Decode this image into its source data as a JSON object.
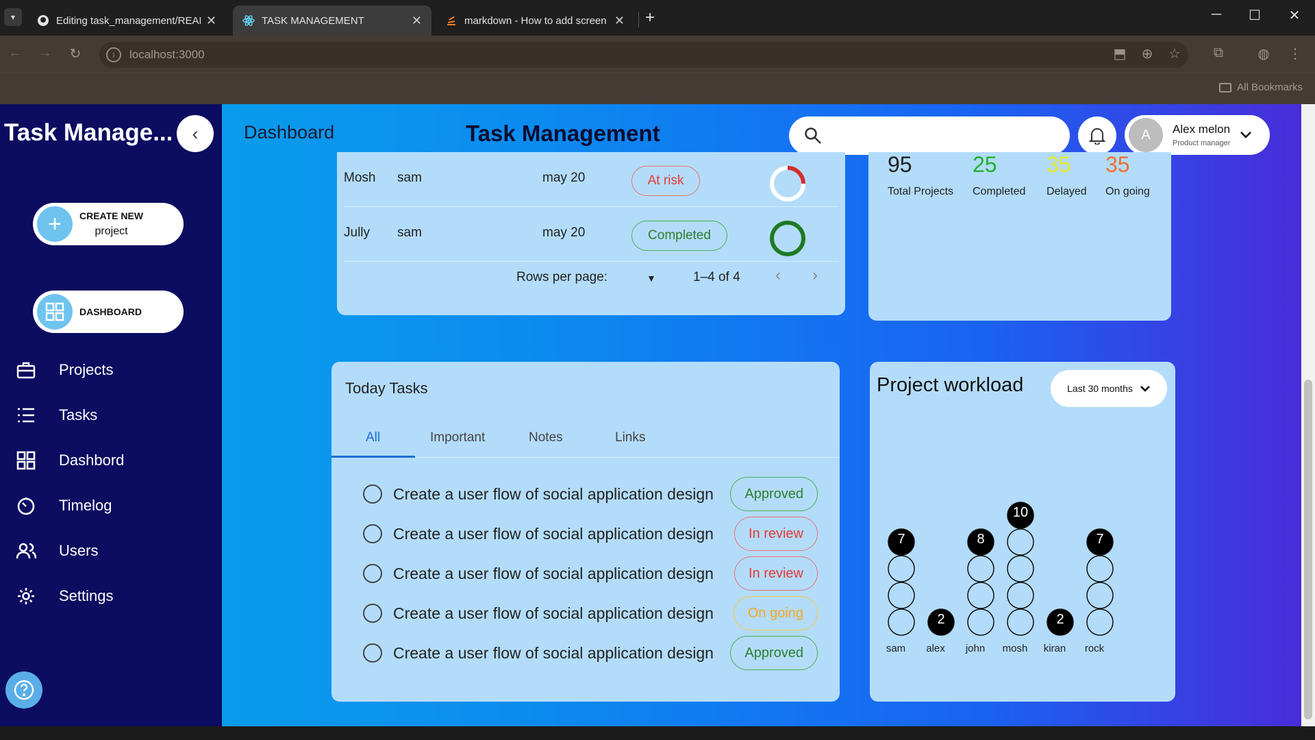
{
  "browser": {
    "tabs": [
      {
        "title": "Editing task_management/READ",
        "active": false
      },
      {
        "title": "TASK MANAGEMENT",
        "active": true
      },
      {
        "title": "markdown - How to add screen",
        "active": false
      }
    ],
    "url": "localhost:3000",
    "bookmarks_label": "All Bookmarks"
  },
  "sidebar": {
    "brand": "Task Manage...",
    "create_btn": {
      "line1": "CREATE NEW",
      "line2": "project"
    },
    "dashboard_btn": "DASHBOARD",
    "items": [
      {
        "label": "Projects",
        "icon": "briefcase-icon"
      },
      {
        "label": "Tasks",
        "icon": "list-icon"
      },
      {
        "label": "Dashbord",
        "icon": "grid-icon"
      },
      {
        "label": "Timelog",
        "icon": "timer-icon"
      },
      {
        "label": "Users",
        "icon": "users-icon"
      },
      {
        "label": "Settings",
        "icon": "gear-icon"
      }
    ]
  },
  "header": {
    "breadcrumb": "Dashboard",
    "title": "Task Management",
    "search_placeholder": "",
    "user": {
      "initial": "A",
      "name": "Alex melon",
      "role": "Product manager"
    }
  },
  "project_table": {
    "rows": [
      {
        "name": "Mosh",
        "manager": "sam",
        "due": "may 20",
        "status": "At risk",
        "status_color": "#e53935",
        "progress": 0.25
      },
      {
        "name": "Jully",
        "manager": "sam",
        "due": "may 20",
        "status": "Completed",
        "status_color": "#2e7d32",
        "progress": 1.0
      }
    ],
    "pager": {
      "rows_label": "Rows per page:",
      "range": "1–4 of 4"
    }
  },
  "overview": {
    "stats": [
      {
        "value": "95",
        "label": "Total Projects",
        "color": "#222222"
      },
      {
        "value": "25",
        "label": "Completed",
        "color": "#1fb12f"
      },
      {
        "value": "35",
        "label": "Delayed",
        "color": "#e8e82a"
      },
      {
        "value": "35",
        "label": "On going",
        "color": "#f07030"
      }
    ]
  },
  "today_tasks": {
    "title": "Today Tasks",
    "tabs": [
      "All",
      "Important",
      "Notes",
      "Links"
    ],
    "active_tab": 0,
    "tasks": [
      {
        "text": "Create a user flow of social application design",
        "status": "Approved",
        "color": "#2e7d32"
      },
      {
        "text": "Create a user flow of social application design",
        "status": "In review",
        "color": "#e53935"
      },
      {
        "text": "Create a user flow of social application design",
        "status": "In review",
        "color": "#e53935"
      },
      {
        "text": "Create a user flow of social application design",
        "status": "On going",
        "color": "#f5a623"
      },
      {
        "text": "Create a user flow of social application design",
        "status": "Approved",
        "color": "#2e7d32"
      }
    ]
  },
  "workload": {
    "title": "Project workload",
    "period": "Last 30 months"
  },
  "chart_data": {
    "type": "bar",
    "title": "Project workload",
    "categories": [
      "sam",
      "alex",
      "john",
      "mosh",
      "kiran",
      "rock"
    ],
    "values": [
      7,
      2,
      8,
      10,
      2,
      7
    ],
    "circles": [
      4,
      1,
      4,
      5,
      1,
      4
    ]
  }
}
